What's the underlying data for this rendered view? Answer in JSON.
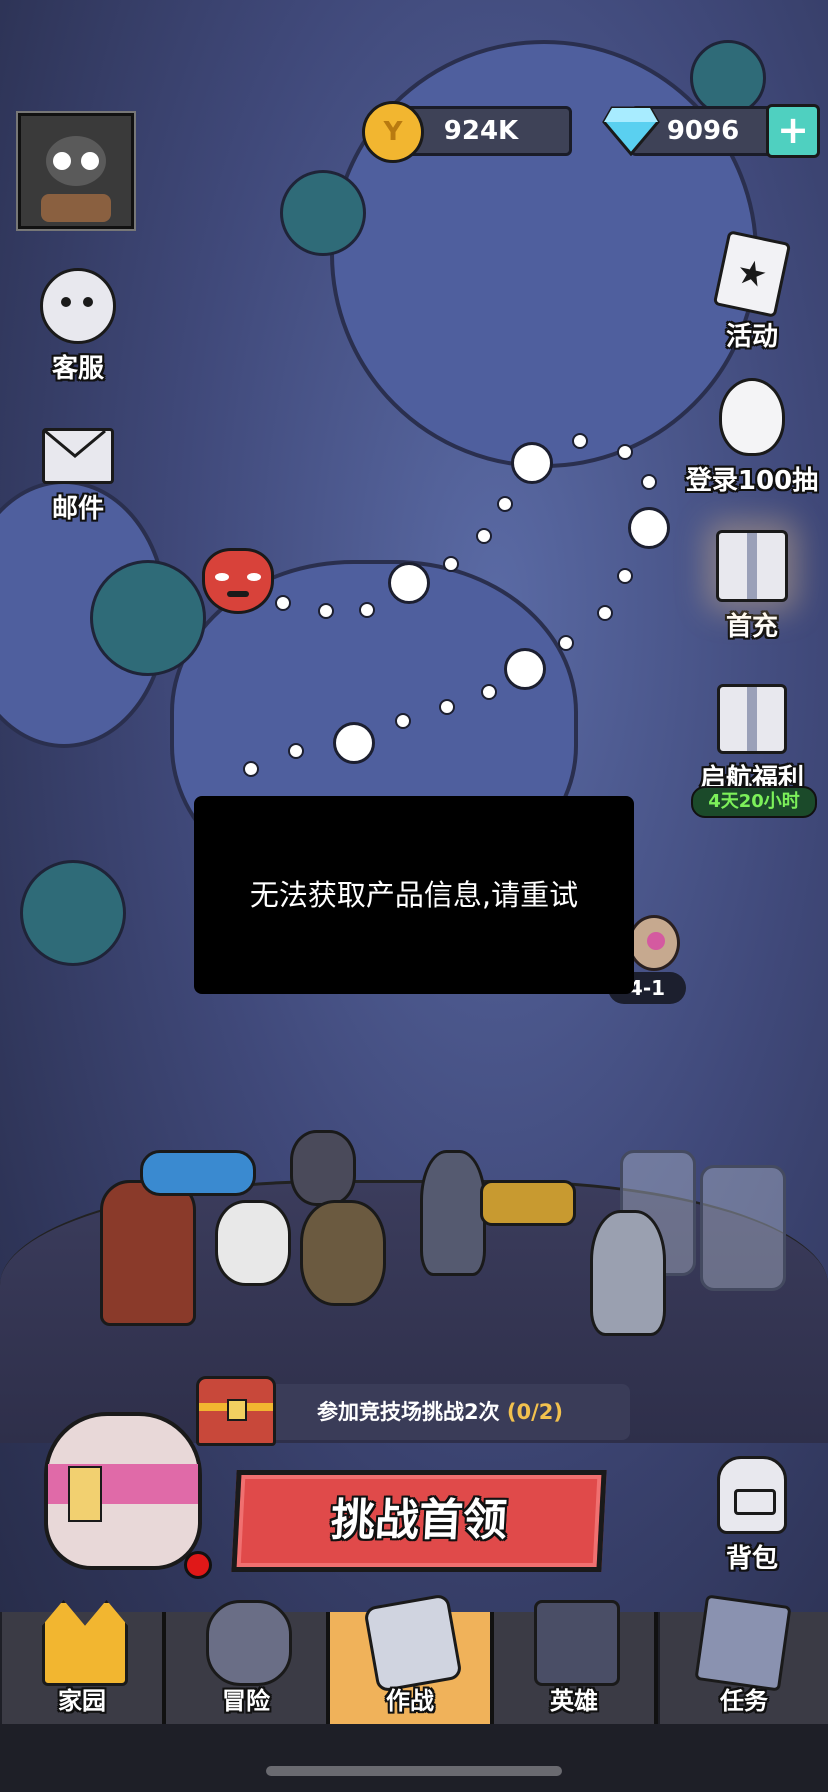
{
  "currency": {
    "gold": "924K",
    "gems": "9096",
    "gold_icon": "gold-coin-icon",
    "gem_icon": "diamond-icon",
    "add_icon": "plus-icon"
  },
  "left_menu": [
    {
      "id": "support",
      "label": "客服",
      "icon": "headset-icon"
    },
    {
      "id": "mail",
      "label": "邮件",
      "icon": "envelope-icon"
    }
  ],
  "right_menu": [
    {
      "id": "events",
      "label": "活动",
      "icon": "event-card-icon"
    },
    {
      "id": "login-draw",
      "label": "登录100抽",
      "icon": "egg-icon"
    },
    {
      "id": "first-recharge",
      "label": "首充",
      "icon": "gift-icon"
    },
    {
      "id": "voyage-bonus",
      "label": "启航福利",
      "icon": "gift-box-icon",
      "timer": "4天20小时"
    }
  ],
  "stage": {
    "label": "4-1"
  },
  "toast": {
    "message": "无法获取产品信息,请重试"
  },
  "quest": {
    "text": "参加竞技场挑战2次",
    "progress": "(0/2)",
    "progress_color": "#f2c14e"
  },
  "challenge_button": {
    "label": "挑战首领"
  },
  "backpack": {
    "label": "背包"
  },
  "tabs": [
    {
      "label": "家园",
      "icon": "crown-icon"
    },
    {
      "label": "冒险",
      "icon": "sword-duck-icon"
    },
    {
      "label": "作战",
      "icon": "crossed-swords-icon"
    },
    {
      "label": "英雄",
      "icon": "hero-book-icon"
    },
    {
      "label": "任务",
      "icon": "scroll-icon"
    }
  ],
  "colors": {
    "active_tab": "#f0b25a",
    "timer_bg": "#1b4a2a",
    "timer_text": "#7cf05a",
    "button_red": "#e04a4a"
  }
}
